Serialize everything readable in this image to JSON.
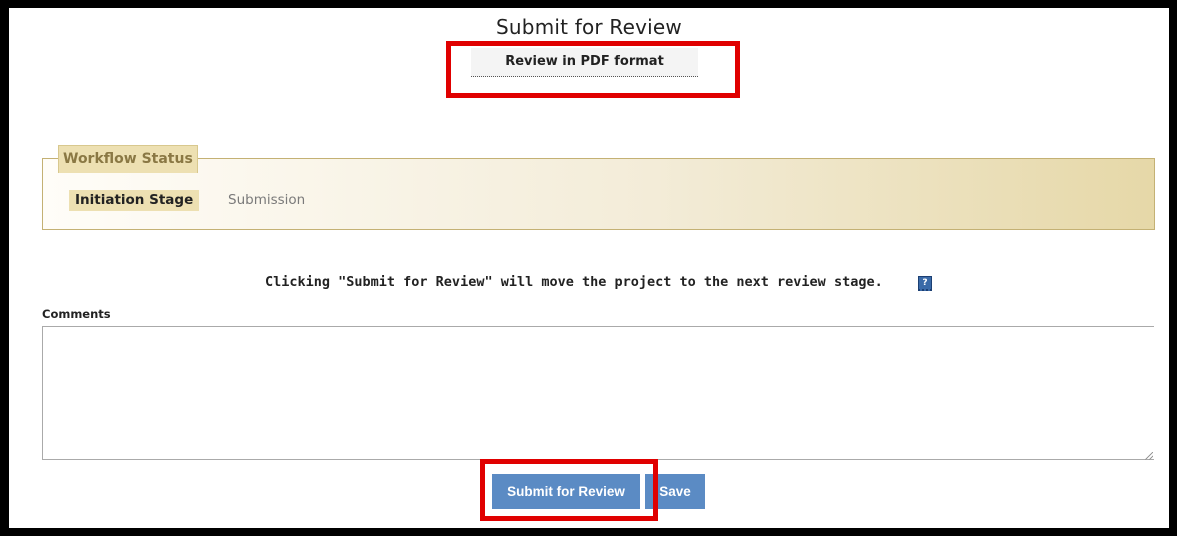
{
  "page": {
    "title": "Submit for Review",
    "pdf_link": "Review in PDF format"
  },
  "workflow": {
    "legend": "Workflow Status",
    "stages": [
      {
        "label": "Initiation Stage",
        "active": true
      },
      {
        "label": "Submission",
        "active": false
      }
    ]
  },
  "info": {
    "message": "Clicking \"Submit for Review\" will move the project to the next review stage.",
    "help_icon_glyph": "?"
  },
  "comments": {
    "label": "Comments",
    "value": ""
  },
  "buttons": {
    "submit_label": "Submit for Review",
    "save_label": "Save"
  },
  "colors": {
    "button": "#5b8bc4",
    "highlight": "#e00000",
    "workflow_accent": "#ede0b2"
  },
  "icons": [
    "help-icon",
    "resize-grip-icon"
  ]
}
